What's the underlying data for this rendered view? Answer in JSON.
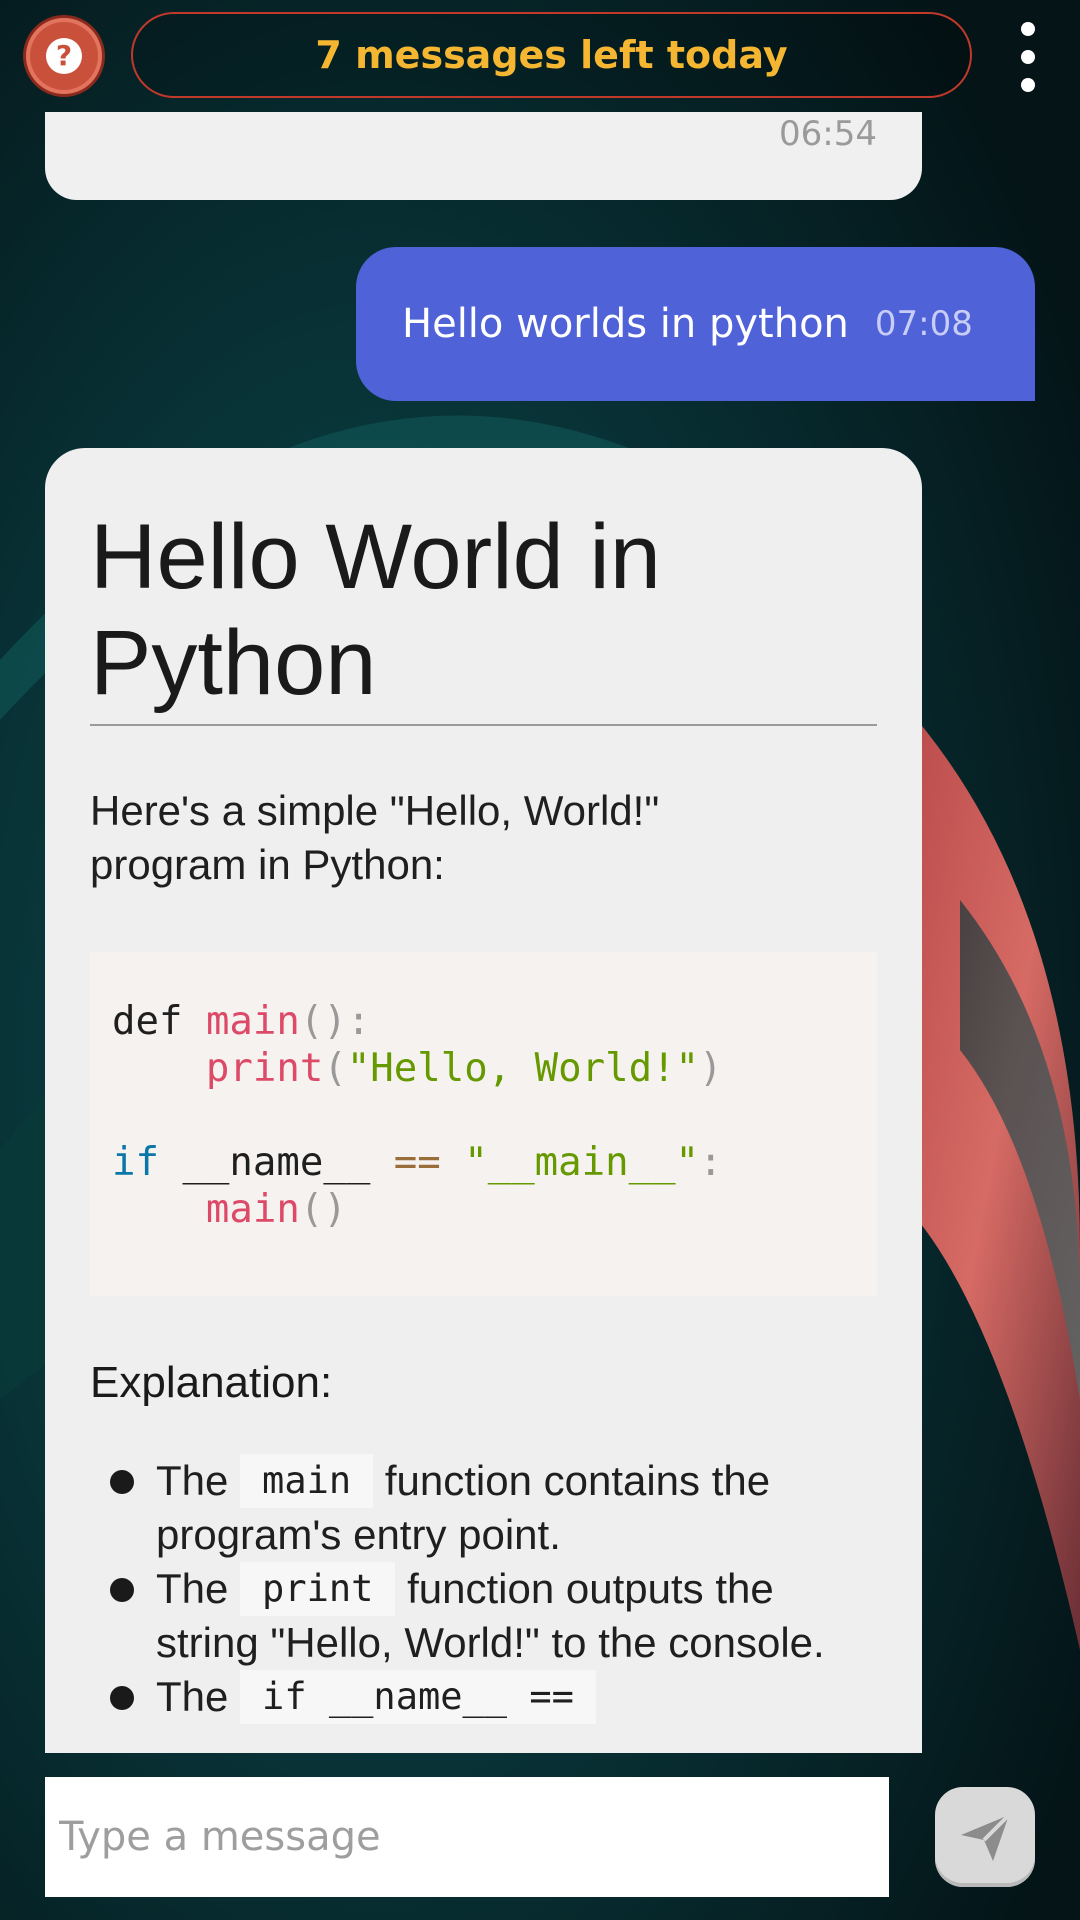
{
  "topbar": {
    "help_icon": "question-circle-icon",
    "help_glyph": "?",
    "quota_text": "7 messages left today",
    "menu_icon": "more-vertical-icon"
  },
  "messages": {
    "previous": {
      "time": "06:54"
    },
    "user": {
      "text": "Hello worlds in python",
      "time": "07:08"
    },
    "bot": {
      "title": "Hello World in Python",
      "intro": "Here's a simple \"Hello, World!\" program in Python:",
      "code": {
        "l1_kw": "def",
        "l1_fn": "main",
        "l1_punc": "():",
        "l2_fn": "print",
        "l2_po": "(",
        "l2_str": "\"Hello, World!\"",
        "l2_pc": ")",
        "l4_kw": "if",
        "l4_name": "__name__",
        "l4_op": "==",
        "l4_str": "\"__main__\"",
        "l4_colon": ":",
        "l5_fn": "main",
        "l5_punc": "()"
      },
      "explanation_heading": "Explanation:",
      "bullets": [
        {
          "pre": "The",
          "code": "main",
          "post": "function contains the program's entry point."
        },
        {
          "pre": "The",
          "code": "print",
          "post": "function outputs the string \"Hello, World!\" to the console."
        },
        {
          "pre": "The",
          "code": "if __name__ ==",
          "post": ""
        }
      ]
    }
  },
  "composer": {
    "placeholder": "Type a message",
    "send_icon": "send-icon"
  },
  "colors": {
    "user_bubble": "#4f62d8",
    "bot_bubble": "#efefef",
    "quota_text": "#f5b731",
    "quota_border": "#c0392b",
    "help_button": "#c9513c"
  }
}
